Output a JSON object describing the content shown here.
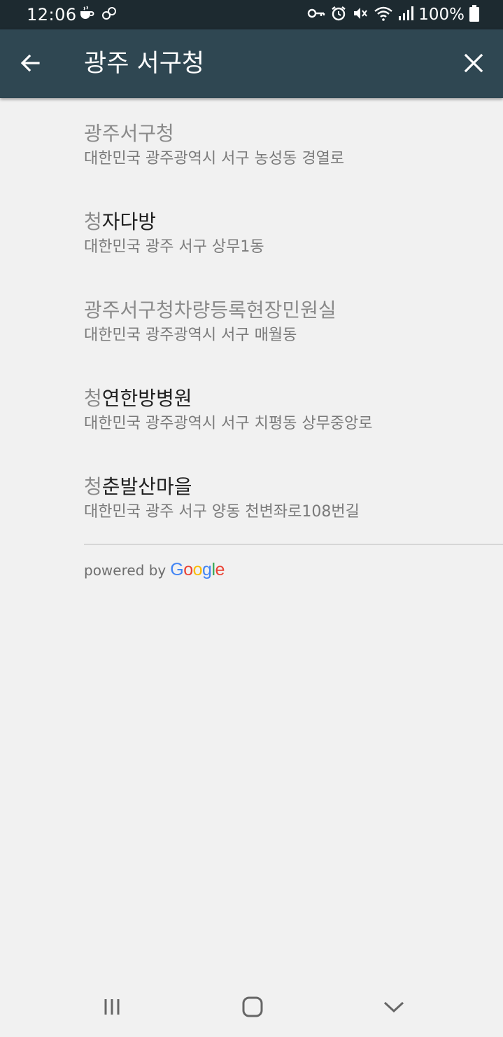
{
  "status_bar": {
    "time": "12:06",
    "battery_percent": "100%",
    "icons_left": [
      "cup-icon",
      "link-icon"
    ],
    "icons_right": [
      "key-icon",
      "alarm-icon",
      "mute-icon",
      "wifi-icon",
      "signal-icon",
      "battery-icon"
    ]
  },
  "app_bar": {
    "title": "광주 서구청",
    "back_icon": "arrow-left-icon",
    "close_icon": "close-icon",
    "background": "#2f4752"
  },
  "results": [
    {
      "match": "",
      "rest": "광주서구청",
      "address": "대한민국 광주광역시 서구 농성동 경열로",
      "all_match": true
    },
    {
      "match": "청",
      "rest": "자다방",
      "address": "대한민국 광주 서구 상무1동",
      "all_match": false
    },
    {
      "match": "",
      "rest": "광주서구청차량등록현장민원실",
      "address": "대한민국 광주광역시 서구 매월동",
      "all_match": true
    },
    {
      "match": "청",
      "rest": "연한방병원",
      "address": "대한민국 광주광역시 서구 치평동 상무중앙로",
      "all_match": false
    },
    {
      "match": "청",
      "rest": "춘발산마을",
      "address": "대한민국 광주 서구 양동 천변좌로108번길",
      "all_match": false
    }
  ],
  "attribution": {
    "powered_by": "powered by",
    "google_letters": [
      "G",
      "o",
      "o",
      "g",
      "l",
      "e"
    ],
    "google_colors": [
      "#4285F4",
      "#EA4335",
      "#FBBC05",
      "#4285F4",
      "#34A853",
      "#EA4335"
    ]
  },
  "nav_bar": {
    "recent_icon": "recent-apps-icon",
    "home_icon": "home-icon",
    "back_icon": "chevron-down-icon"
  }
}
